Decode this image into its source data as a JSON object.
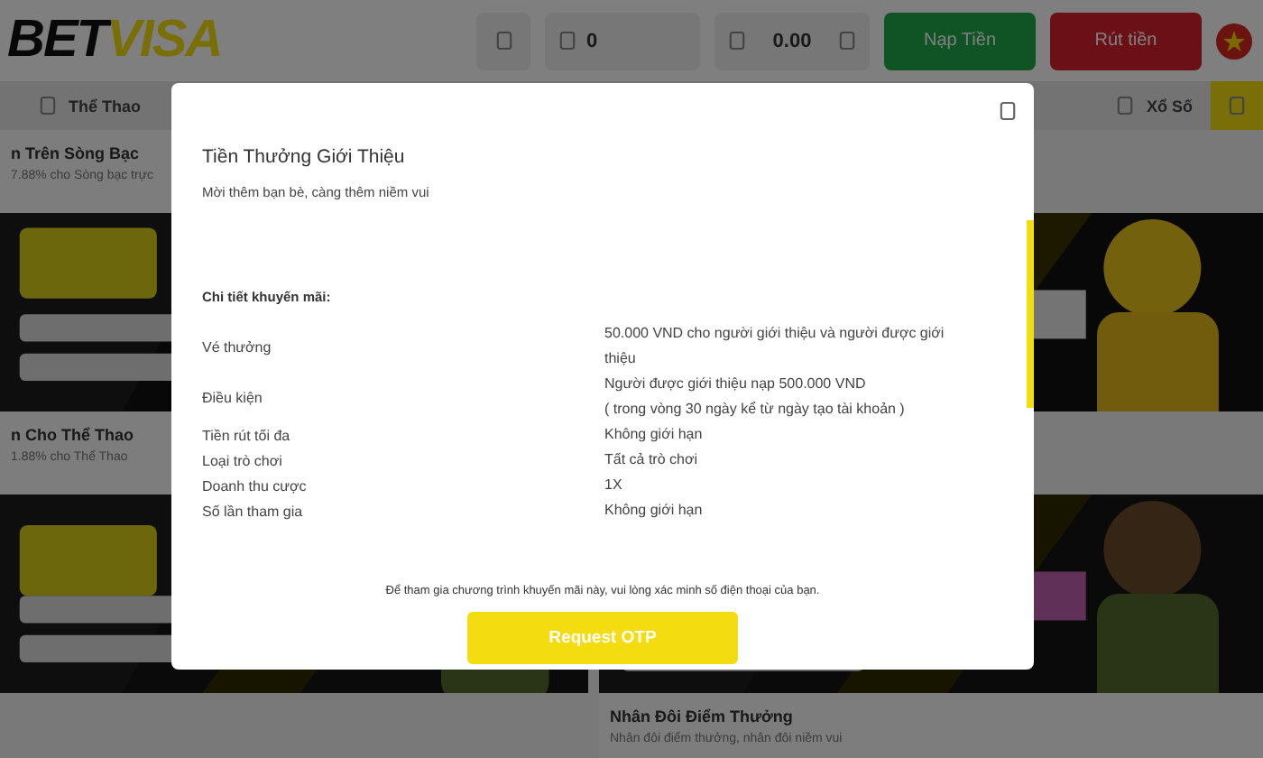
{
  "header": {
    "logo_part1": "BET",
    "logo_part2": "VISA",
    "balance_1": "0",
    "balance_2": "0.00",
    "buttons": [
      {
        "label": "Nạp Tiền",
        "kind": "deposit"
      },
      {
        "label": "Rút tiền",
        "kind": "withdraw"
      }
    ]
  },
  "nav": {
    "items": [
      {
        "label": "Thể Thao",
        "kind": "text",
        "selected": false
      },
      {
        "label": "Xổ Số",
        "kind": "text",
        "selected": false
      },
      {
        "kind": "icon",
        "selected": true
      }
    ]
  },
  "promos": {
    "left": [
      {
        "title": "n Trên Sòng Bạc",
        "subtitle": "7.88% cho Sòng bạc trực"
      },
      {
        "title": "n Cho Thể Thao",
        "subtitle": "1.88% cho Thể Thao"
      }
    ],
    "right": [
      {
        "title": "Nhân Đôi Điểm Thưởng",
        "subtitle": "Nhân đôi điểm thưởng, nhân đôi niềm vui"
      }
    ]
  },
  "modal": {
    "title": "Tiền Thưởng Giới Thiệu",
    "subtitle": "Mời thêm bạn bè, càng thêm niềm vui",
    "section_title": "Chi tiết khuyến mãi:",
    "details": [
      {
        "label": "Vé thưởng",
        "value": [
          "50.000 VND cho người giới thiệu và người được giới thiệu"
        ]
      },
      {
        "label": "Điều kiện",
        "value": [
          "Người được giới thiệu nạp 500.000 VND",
          "( trong vòng 30 ngày kể từ ngày tạo tài khoản )"
        ]
      },
      {
        "label": "Tiền rút tối đa",
        "value": [
          "Không giới hạn"
        ]
      },
      {
        "label": "Loại trò chơi",
        "value": [
          "Tất cả trò chơi"
        ]
      },
      {
        "label": "Doanh thu cược",
        "value": [
          "1X"
        ]
      },
      {
        "label": "Số lần tham gia",
        "value": [
          "Không giới hạn"
        ]
      }
    ],
    "note": "Để tham gia chương trình khuyến mãi này, vui lòng xác minh số điện thoại của bạn.",
    "button": "Request OTP"
  }
}
